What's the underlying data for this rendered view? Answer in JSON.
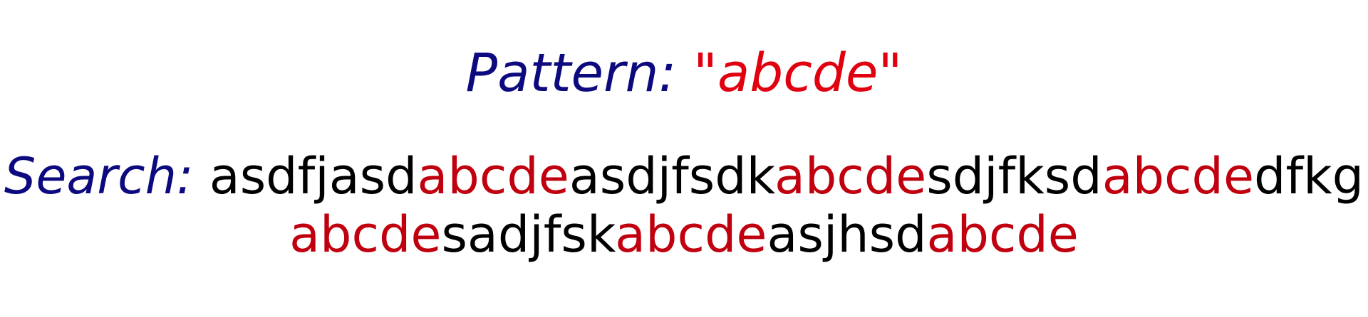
{
  "pattern": {
    "label": "Pattern:",
    "value": "\"abcde\""
  },
  "search": {
    "label": "Search:",
    "lines": [
      [
        {
          "text": "asdfjasd",
          "match": false
        },
        {
          "text": "abcde",
          "match": true
        },
        {
          "text": "asdjfsdk",
          "match": false
        },
        {
          "text": "abcde",
          "match": true
        },
        {
          "text": "sdjfksd",
          "match": false
        },
        {
          "text": "abcde",
          "match": true
        },
        {
          "text": "dfkg",
          "match": false
        }
      ],
      [
        {
          "text": "abcde",
          "match": true
        },
        {
          "text": "sadjfsk",
          "match": false
        },
        {
          "text": "abcde",
          "match": true
        },
        {
          "text": "asjhsd",
          "match": false
        },
        {
          "text": "abcde",
          "match": true
        }
      ]
    ]
  },
  "colors": {
    "label": "#0c0a7e",
    "pattern_value": "#e0000f",
    "match": "#c0000f",
    "text": "#000000"
  }
}
